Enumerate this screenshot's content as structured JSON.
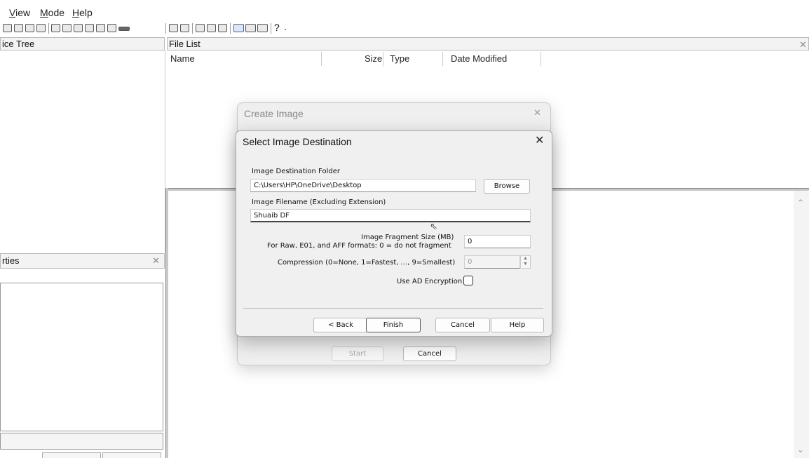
{
  "menu": [
    "View",
    "Mode",
    "Help"
  ],
  "panels": {
    "evidence_tree_title": "ice Tree",
    "file_list_title": "File List",
    "properties_title": "rties"
  },
  "file_list_columns": [
    "Name",
    "Size",
    "Type",
    "Date Modified"
  ],
  "create_image_dialog": {
    "title": "Create Image",
    "start_label": "Start",
    "cancel_label": "Cancel"
  },
  "select_dest_dialog": {
    "title": "Select Image Destination",
    "dest_folder_label": "Image Destination Folder",
    "dest_folder_value": "C:\\Users\\HP\\OneDrive\\Desktop",
    "browse_label": "Browse",
    "filename_label": "Image Filename (Excluding Extension)",
    "filename_value": "Shuaib DF",
    "fragment_label_line1": "Image Fragment Size (MB)",
    "fragment_label_line2": "For Raw, E01, and AFF formats: 0 = do not fragment",
    "fragment_value": "0",
    "compression_label": "Compression (0=None, 1=Fastest, ..., 9=Smallest)",
    "compression_value": "0",
    "ad_encryption_label": "Use AD Encryption",
    "ad_encryption_checked": false,
    "back_label": "< Back",
    "finish_label": "Finish",
    "cancel_label": "Cancel",
    "help_label": "Help"
  },
  "colors": {
    "dialog_bg": "#f0f0f0",
    "panel_header_bg": "#f3f3f3",
    "text": "#111111"
  }
}
